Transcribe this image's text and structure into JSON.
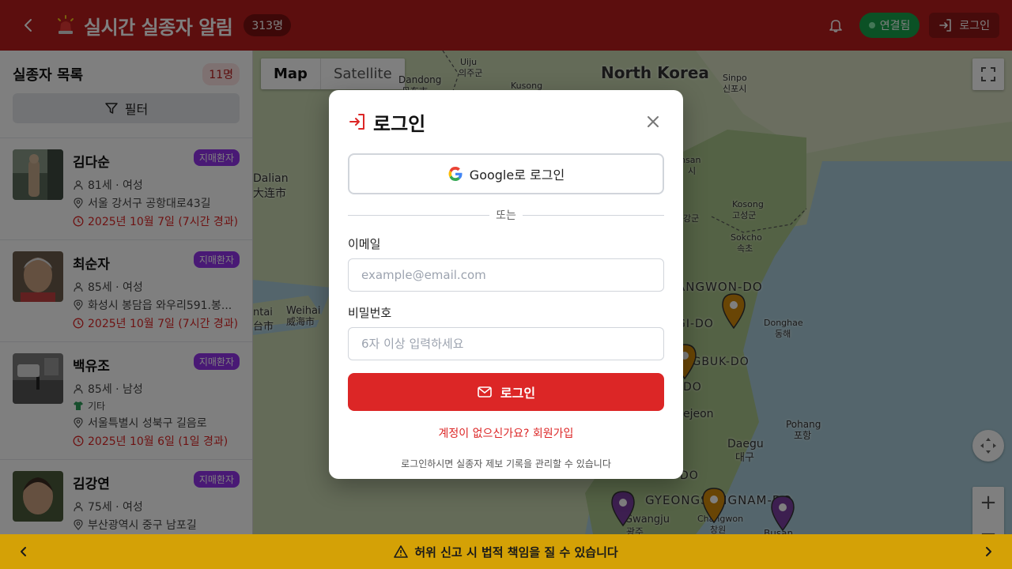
{
  "header": {
    "title": "실시간 실종자 알림",
    "total_count": "313명",
    "status": "연결됨",
    "login_label": "로그인"
  },
  "sidebar": {
    "title": "실종자 목록",
    "count": "11명",
    "filter_label": "필터",
    "persons": [
      {
        "name": "김다순",
        "tag": "지매환자",
        "age_gender": "81세 · 여성",
        "address": "서울 강서구 공항대로43길",
        "time": "2025년 10월 7일 (7시간 경과)"
      },
      {
        "name": "최순자",
        "tag": "지매환자",
        "age_gender": "85세 · 여성",
        "address": "화성시 봉담읍 와우리591.봉...",
        "time": "2025년 10월 7일 (7시간 경과)"
      },
      {
        "name": "백유조",
        "tag": "지매환자",
        "age_gender": "85세 · 남성",
        "clothing": "기타",
        "address": "서울특별시 성북구 길음로",
        "time": "2025년 10월 6일 (1일 경과)"
      },
      {
        "name": "김강연",
        "tag": "지매환자",
        "age_gender": "75세 · 여성",
        "address": "부산광역시 중구 남포길"
      }
    ]
  },
  "map": {
    "types": [
      "Map",
      "Satellite"
    ],
    "active_type": "Map",
    "labels": {
      "north_korea": "North Korea",
      "uiju": "Uiju",
      "uiju_kr": "의주군",
      "dandong": "Dandong",
      "dandong_cn": "丹东市",
      "kusong": "Kusong",
      "sinpo": "Sinpo",
      "sinpo_kr": "신포시",
      "dalian": "Dalian",
      "dalian_cn": "大连市",
      "weihai": "Weihai",
      "weihai_cn": "威海市",
      "yantai": "ntai",
      "yantai_cn": "台市",
      "kosong": "Kosong",
      "kosong_kr": "고성군",
      "sokcho": "Sokcho",
      "sokcho_kr": "속초",
      "gangwon": "ANGWON-DO",
      "gyeonggi": "GI-DO",
      "donghae": "Donghae",
      "donghae_kr": "동해",
      "gyeongbuk": "NGBUK-DO",
      "do": "DO",
      "daejeon": "ejeon",
      "pohang": "Pohang",
      "pohang_kr": "포항",
      "daegu": "Daegu",
      "daegu_kr": "대구",
      "gyeongnam": "GYEONGSANGNAM-DO",
      "gwangju": "Gwangju",
      "gwangju_kr": "광주",
      "changwon": "Changwon",
      "changwon_kr": "창원",
      "busan": "Busan",
      "sansan": "nsan",
      "sansan_kr": "시",
      "gangg": "강군",
      "jeolla": "DO"
    }
  },
  "modal": {
    "title": "로그인",
    "google_label": "Google로 로그인",
    "divider": "또는",
    "email_label": "이메일",
    "email_placeholder": "example@email.com",
    "email_value": "",
    "password_label": "비밀번호",
    "password_placeholder": "6자 이상 입력하세요",
    "password_value": "",
    "submit_label": "로그인",
    "signup_label": "계정이 없으신가요? 회원가입",
    "note": "로그인하시면 실종자 제보 기록을 관리할 수 있습니다"
  },
  "bottom_bar": {
    "message": "허위 신고 시 법적 책임을 질 수 있습니다"
  },
  "colors": {
    "header": "#b81c1c",
    "accent": "#dc2626",
    "tag": "#9333ea",
    "connected": "#16a34a",
    "bottom_bar": "#d4a106"
  }
}
